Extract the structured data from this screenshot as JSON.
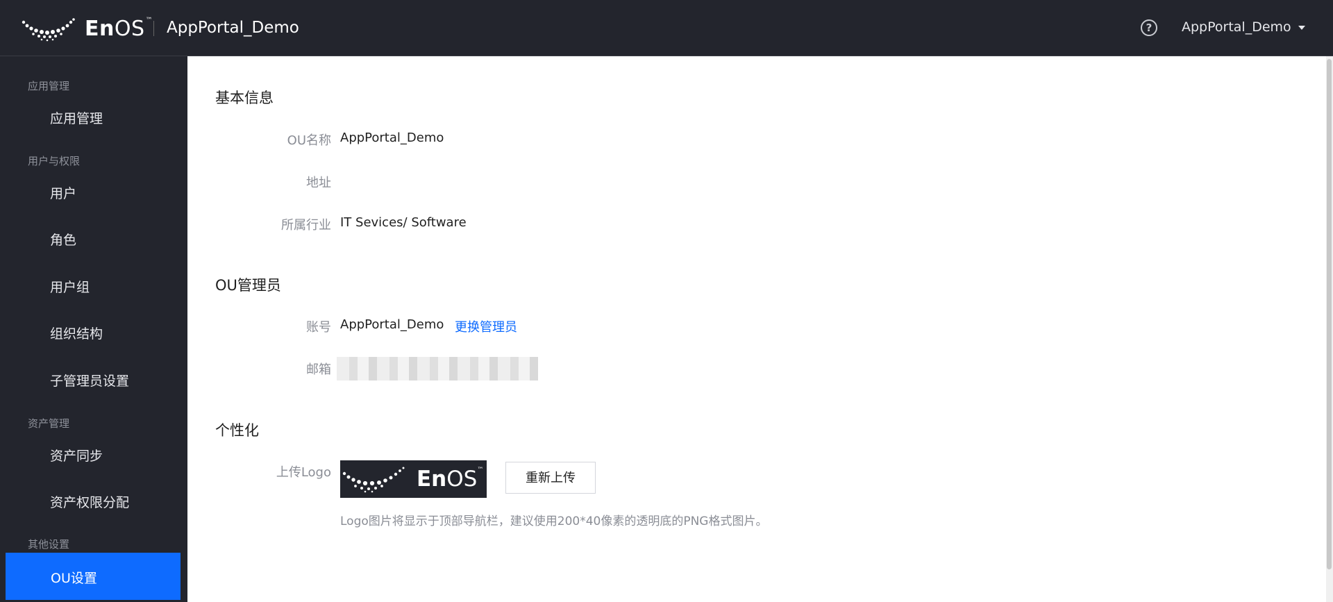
{
  "header": {
    "brand": "EnOS",
    "brand_bold": "En",
    "brand_light": "OS",
    "trademark": "™",
    "app_title": "AppPortal_Demo",
    "help_glyph": "?",
    "user_label": "AppPortal_Demo"
  },
  "sidebar": {
    "groups": [
      {
        "label": "应用管理",
        "items": [
          {
            "label": "应用管理"
          }
        ]
      },
      {
        "label": "用户与权限",
        "items": [
          {
            "label": "用户"
          },
          {
            "label": "角色"
          },
          {
            "label": "用户组"
          },
          {
            "label": "组织结构"
          },
          {
            "label": "子管理员设置"
          }
        ]
      },
      {
        "label": "资产管理",
        "items": [
          {
            "label": "资产同步"
          },
          {
            "label": "资产权限分配"
          }
        ]
      },
      {
        "label": "其他设置",
        "items": [
          {
            "label": "OU设置",
            "active": true
          }
        ]
      }
    ]
  },
  "basic_info": {
    "title": "基本信息",
    "ou_name_label": "OU名称",
    "ou_name_value": "AppPortal_Demo",
    "address_label": "地址",
    "address_value": "",
    "industry_label": "所属行业",
    "industry_value": "IT Sevices/ Software"
  },
  "ou_admin": {
    "title": "OU管理员",
    "account_label": "账号",
    "account_value": "AppPortal_Demo",
    "change_admin_link": "更换管理员",
    "email_label": "邮箱"
  },
  "personalization": {
    "title": "个性化",
    "upload_logo_label": "上传Logo",
    "reupload_button": "重新上传",
    "hint": "Logo图片将显示于顶部导航栏，建议使用200*40像素的透明底的PNG格式图片。"
  },
  "colors": {
    "accent": "#0e6bff",
    "sidebar_bg": "#23252d",
    "header_bg": "#23252d"
  }
}
